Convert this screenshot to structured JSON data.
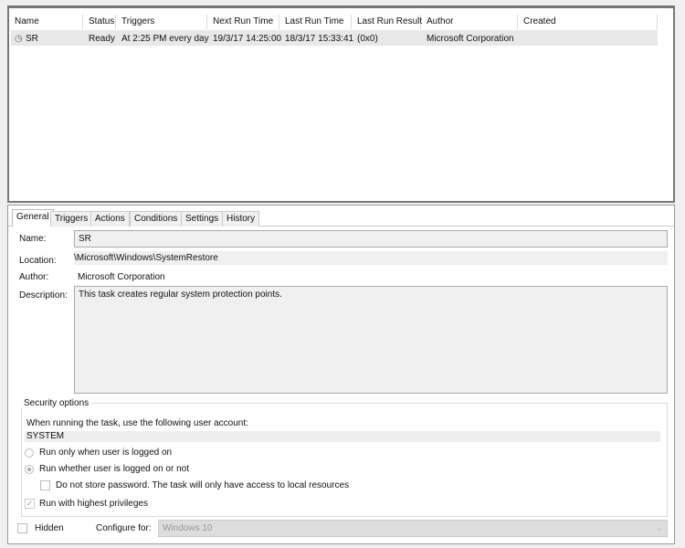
{
  "task_list": {
    "columns": [
      "Name",
      "Status",
      "Triggers",
      "Next Run Time",
      "Last Run Time",
      "Last Run Result",
      "Author",
      "Created"
    ],
    "rows": [
      {
        "icon": "clock-icon",
        "name": "SR",
        "status": "Ready",
        "triggers": "At 2:25 PM every day",
        "next_run": "19/3/17 14:25:00",
        "last_run": "18/3/17 15:33:41",
        "last_result": "(0x0)",
        "author": "Microsoft Corporation",
        "created": ""
      }
    ]
  },
  "tabs": [
    "General",
    "Triggers",
    "Actions",
    "Conditions",
    "Settings",
    "History"
  ],
  "general": {
    "name_label": "Name:",
    "name_value": "SR",
    "location_label": "Location:",
    "location_value": "\\Microsoft\\Windows\\SystemRestore",
    "author_label": "Author:",
    "author_value": "Microsoft Corporation",
    "description_label": "Description:",
    "description_value": "This task creates regular system protection points."
  },
  "security": {
    "title": "Security options",
    "account_prompt": "When running the task, use the following user account:",
    "account": "SYSTEM",
    "radio_logged_on": "Run only when user is logged on",
    "radio_whether": "Run whether user is logged on or not",
    "selected": "radio_whether",
    "no_store_password": "Do not store password.  The task will only have access to local resources",
    "no_store_password_checked": false,
    "highest_privileges": "Run with highest privileges",
    "highest_privileges_checked": true
  },
  "footer": {
    "hidden_label": "Hidden",
    "hidden_checked": false,
    "configure_label": "Configure for:",
    "configure_value": "Windows 10"
  }
}
